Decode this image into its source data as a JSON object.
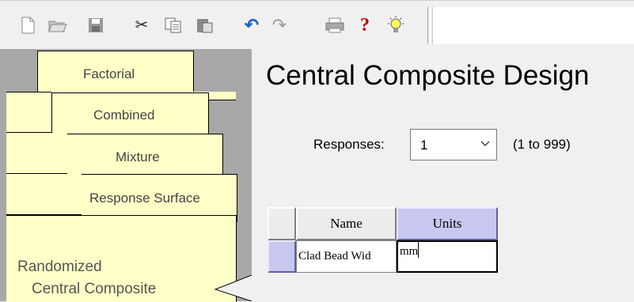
{
  "toolbar": {
    "buttons": [
      {
        "name": "new-document-icon",
        "glyph": "🗋"
      },
      {
        "name": "open-folder-icon",
        "glyph": "📂"
      },
      {
        "name": "save-icon",
        "glyph": "🖫"
      },
      {
        "name": "cut-icon",
        "glyph": "✂"
      },
      {
        "name": "copy-icon",
        "glyph": "⎘"
      },
      {
        "name": "paste-icon",
        "glyph": "📋"
      },
      {
        "name": "undo-icon",
        "glyph": "↶"
      },
      {
        "name": "redo-icon",
        "glyph": "↷"
      },
      {
        "name": "print-icon",
        "glyph": "🖶"
      },
      {
        "name": "help-icon",
        "glyph": "?"
      },
      {
        "name": "tip-lightbulb-icon",
        "glyph": "💡"
      }
    ]
  },
  "tabs": {
    "factorial": "Factorial",
    "combined": "Combined",
    "mixture": "Mixture",
    "response_surface": "Response Surface",
    "active_line1": "Randomized",
    "active_line2": "Central Composite"
  },
  "main": {
    "title": "Central Composite Design",
    "responses_label": "Responses:",
    "responses_value": "1",
    "responses_range": "(1 to 999)"
  },
  "grid": {
    "headers": {
      "name": "Name",
      "units": "Units"
    },
    "rows": [
      {
        "name": "Clad Bead Wid",
        "units": "mm"
      }
    ]
  },
  "colors": {
    "tab_fill": "#ffffc8",
    "selected_header": "#c7c7f0",
    "panel_bg": "#a8a8a8"
  }
}
